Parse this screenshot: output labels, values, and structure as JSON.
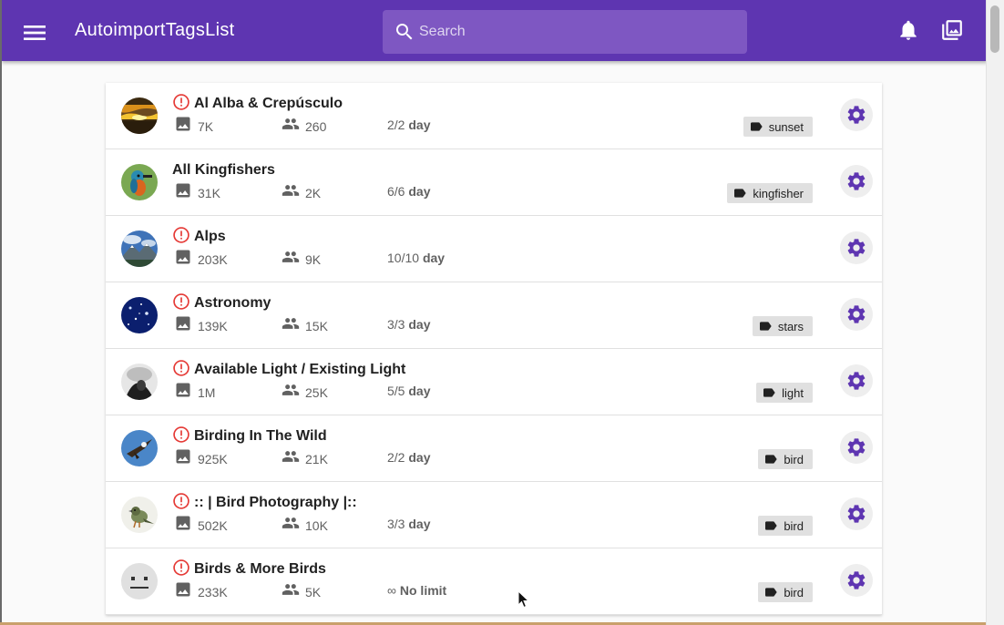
{
  "app": {
    "title": "AutoimportTagsList",
    "search_placeholder": "Search",
    "accent_color": "#5e35b1",
    "icons": {
      "menu": "menu-icon",
      "search": "search-icon",
      "notifications": "bell-icon",
      "gallery": "photo-library-icon"
    }
  },
  "groups": [
    {
      "name": "Al Alba & Crepúsculo",
      "warning": true,
      "photos": "7K",
      "members": "260",
      "limit_count": "2/2",
      "limit_unit": "day",
      "tag": "sunset",
      "avatar": "sunset-avatar"
    },
    {
      "name": "All Kingfishers",
      "warning": false,
      "photos": "31K",
      "members": "2K",
      "limit_count": "6/6",
      "limit_unit": "day",
      "tag": "kingfisher",
      "avatar": "kingfisher-avatar"
    },
    {
      "name": "Alps",
      "warning": true,
      "photos": "203K",
      "members": "9K",
      "limit_count": "10/10",
      "limit_unit": "day",
      "tag": "",
      "avatar": "mountain-avatar"
    },
    {
      "name": "Astronomy",
      "warning": true,
      "photos": "139K",
      "members": "15K",
      "limit_count": "3/3",
      "limit_unit": "day",
      "tag": "stars",
      "avatar": "stars-avatar"
    },
    {
      "name": "Available Light / Existing Light",
      "warning": true,
      "photos": "1M",
      "members": "25K",
      "limit_count": "5/5",
      "limit_unit": "day",
      "tag": "light",
      "avatar": "bw-avatar"
    },
    {
      "name": "Birding In The Wild",
      "warning": true,
      "photos": "925K",
      "members": "21K",
      "limit_count": "2/2",
      "limit_unit": "day",
      "tag": "bird",
      "avatar": "eagle-avatar"
    },
    {
      "name": ":: | Bird Photography |::",
      "warning": true,
      "photos": "502K",
      "members": "10K",
      "limit_count": "3/3",
      "limit_unit": "day",
      "tag": "bird",
      "avatar": "bird-avatar"
    },
    {
      "name": "Birds & More Birds",
      "warning": true,
      "photos": "233K",
      "members": "5K",
      "limit_count": "∞",
      "limit_unit": "No limit",
      "tag": "bird",
      "avatar": "default-face-avatar"
    }
  ]
}
